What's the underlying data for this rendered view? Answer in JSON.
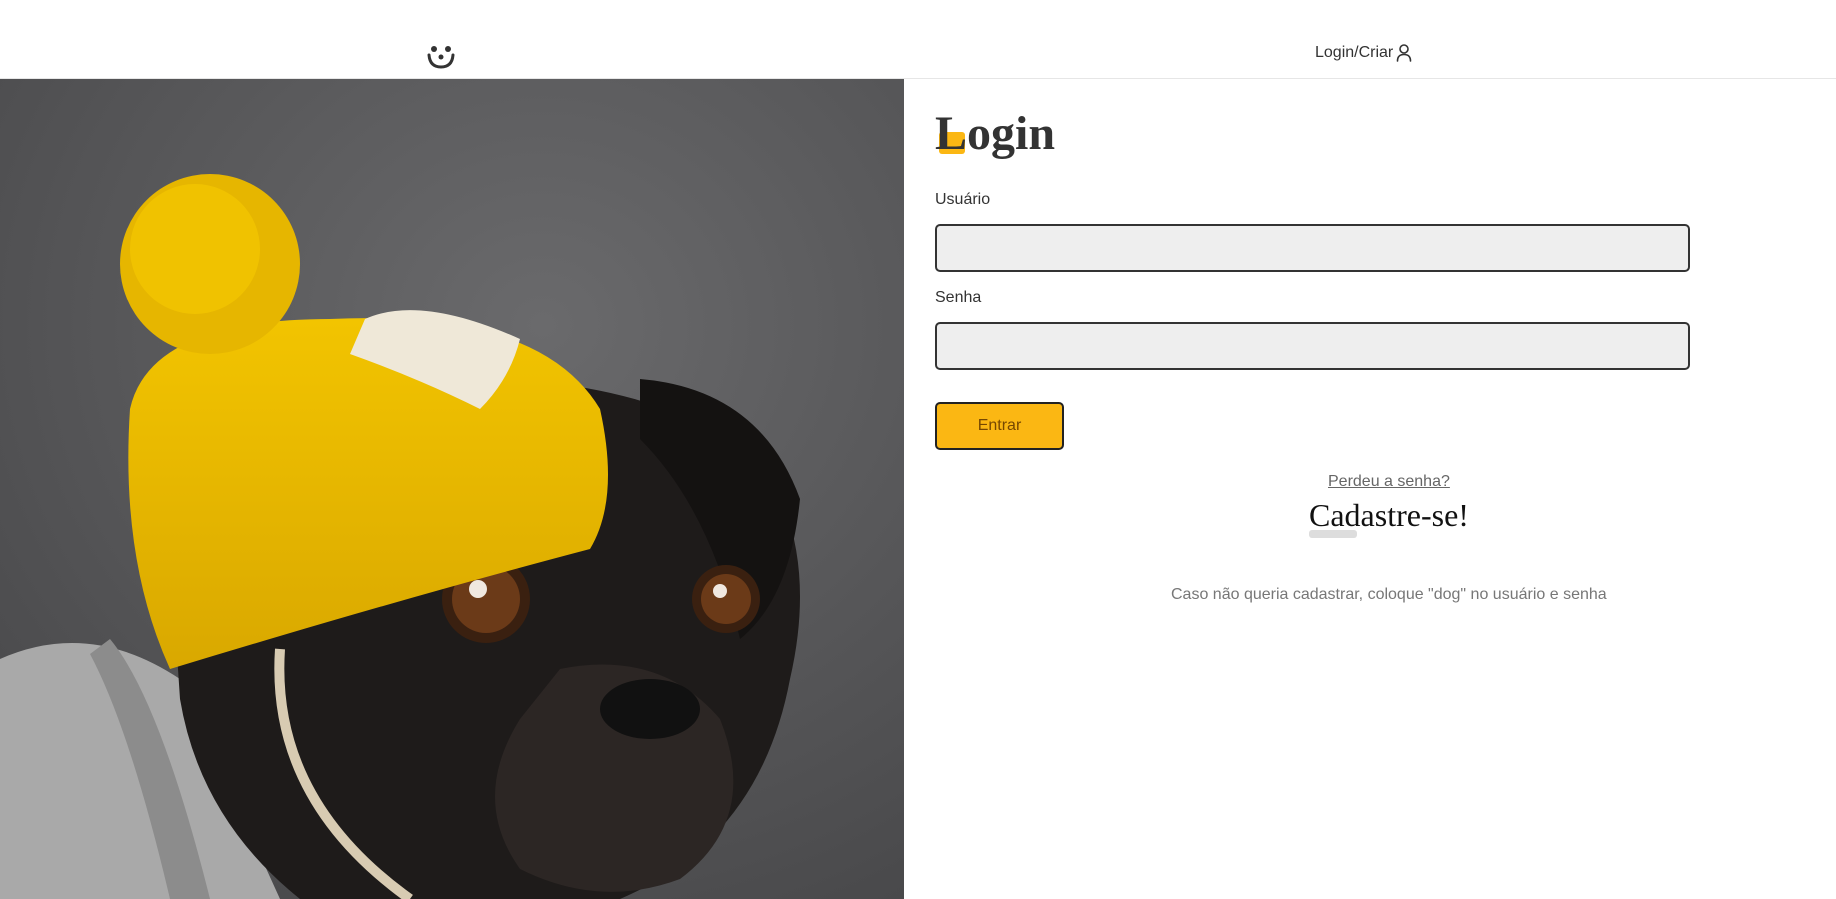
{
  "header": {
    "logo_icon": "dog-face-icon",
    "login_link": "Login/Criar",
    "login_icon": "user-icon"
  },
  "hero": {
    "image": "pug-wearing-yellow-beanie-photo",
    "colors": {
      "beanie": "#e8b800",
      "background": "#5a5a5c",
      "dog": "#1e1b1a"
    }
  },
  "form": {
    "title": "Login",
    "username_label": "Usuário",
    "username_value": "",
    "password_label": "Senha",
    "password_value": "",
    "submit_label": "Entrar",
    "lost_password": "Perdeu a senha?",
    "signup_title": "Cadastre-se!",
    "hint": "Caso não queria cadastrar, coloque \"dog\" no usuário e senha"
  },
  "colors": {
    "accent": "#fbb713",
    "button_text": "#764701",
    "text": "#333333"
  }
}
